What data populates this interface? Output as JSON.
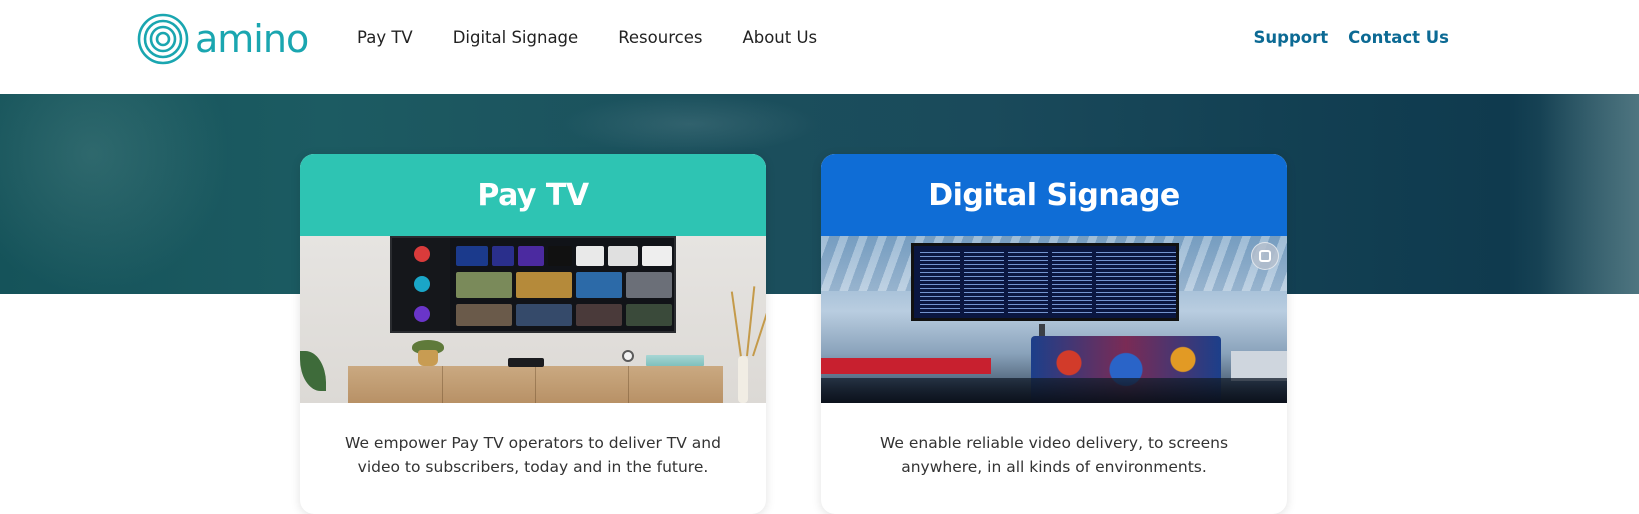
{
  "header": {
    "logo_text": "amino",
    "nav": [
      "Pay TV",
      "Digital Signage",
      "Resources",
      "About Us"
    ],
    "util": [
      "Support",
      "Contact Us"
    ]
  },
  "cards": [
    {
      "title": "Pay TV",
      "text": "We empower Pay TV operators to deliver TV and video to subscribers, today and in the future.",
      "header_color": "#2ec4b3"
    },
    {
      "title": "Digital Signage",
      "text": "We enable reliable video delivery, to screens anywhere, in all kinds of environments.",
      "header_color": "#0f6dd6"
    }
  ],
  "colors": {
    "brand_teal": "#1aa6b0",
    "link_blue": "#0c6a94",
    "hero_dark": "#15535a"
  }
}
